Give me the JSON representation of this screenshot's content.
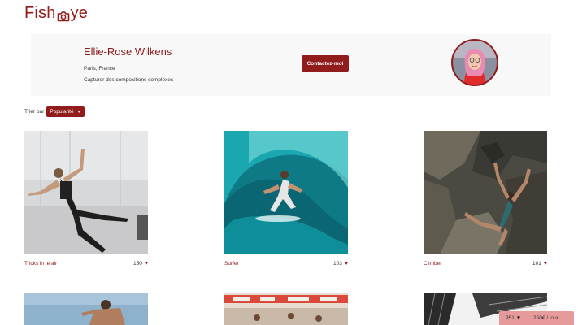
{
  "brand": {
    "logo_left": "Fish",
    "logo_right": "ye",
    "accent": "#901C1C"
  },
  "profile": {
    "name": "Ellie-Rose Wilkens",
    "location": "Paris, France",
    "tagline": "Capturer des compositions complexes",
    "contact_label": "Contactez-moi"
  },
  "sort": {
    "label": "Trier par",
    "selected": "Popularité"
  },
  "photos": [
    {
      "title": "Tricks in te air",
      "likes": "150"
    },
    {
      "title": "Surfer",
      "likes": "103"
    },
    {
      "title": "Climber",
      "likes": "101"
    }
  ],
  "summary": {
    "total_likes": "951",
    "rate": "250€ / jour"
  },
  "icons": {
    "logo": "camera-icon",
    "like": "heart-icon",
    "sort": "chevron-down-icon"
  }
}
